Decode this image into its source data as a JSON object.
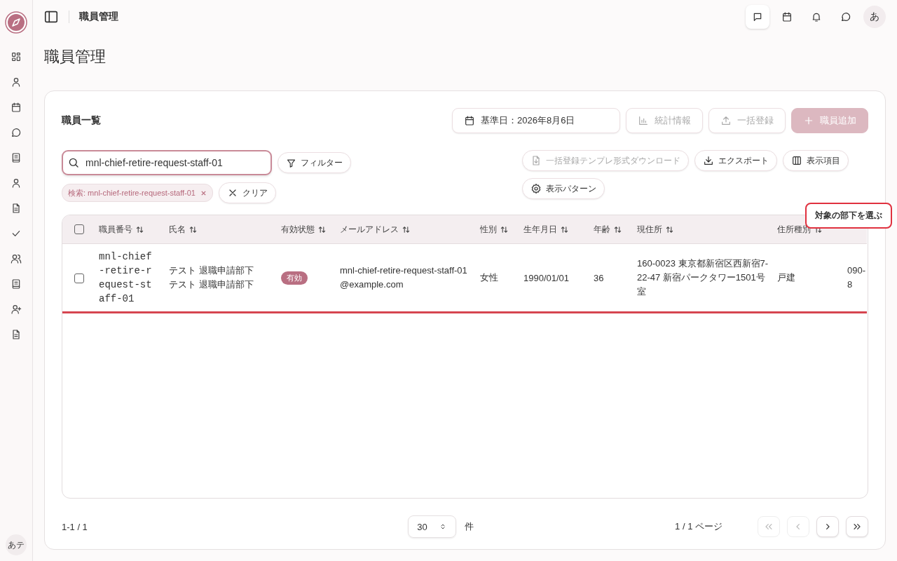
{
  "topbar": {
    "title": "職員管理",
    "avatar": "あ"
  },
  "sidebar": {
    "avatar": "あテ"
  },
  "page_title": "職員管理",
  "card": {
    "title": "職員一覧",
    "header_buttons": [
      {
        "label": "基準日：2026年8月6日",
        "kind": "date",
        "disabled": false
      },
      {
        "label": "統計情報",
        "kind": "stats",
        "disabled": true
      },
      {
        "label": "一括登録",
        "kind": "upload",
        "disabled": true
      },
      {
        "label": "職員追加",
        "kind": "add",
        "disabled": true
      }
    ],
    "search": {
      "value": "mnl-chief-retire-request-staff-01"
    },
    "filter_button": "フィルター",
    "chips": [
      {
        "label": "検索: mnl-chief-retire-request-staff-01"
      }
    ],
    "clear_button": "クリア",
    "tool_buttons": [
      {
        "label": "一括登録テンプレ形式ダウンロード",
        "kind": "template",
        "disabled": true
      },
      {
        "label": "エクスポート",
        "kind": "export",
        "disabled": false
      },
      {
        "label": "表示項目",
        "kind": "columns",
        "disabled": false
      },
      {
        "label": "表示パターン",
        "kind": "settings",
        "disabled": false
      }
    ],
    "table": {
      "header_checked": false,
      "columns": [
        {
          "label": "職員番号"
        },
        {
          "label": "氏名"
        },
        {
          "label": "有効状態"
        },
        {
          "label": "メールアドレス"
        },
        {
          "label": "性別"
        },
        {
          "label": "生年月日"
        },
        {
          "label": "年齢"
        },
        {
          "label": "現住所"
        },
        {
          "label": "住所種別"
        }
      ],
      "rows": [
        {
          "selected": false,
          "highlighted": true,
          "staff_no": "mnl-chief-retire-request-staff-01",
          "name": [
            "テスト 退職申請部下",
            "テスト 退職申請部下"
          ],
          "status": {
            "label": "有効",
            "kind": "active"
          },
          "email": "mnl-chief-retire-request-staff-01@example.com",
          "gender": "女性",
          "birth_date": "1990/01/01",
          "age": "36",
          "address": "160-0023 東京都新宿区西新宿7-22-47 新宿パークタワー1501号室",
          "address_type": "戸建",
          "phone": "090-8"
        }
      ]
    },
    "tooltip": "対象の部下を選ぶ",
    "pagination": {
      "range": "1-1 / 1",
      "page_size": "30",
      "unit": "件",
      "page_info": "1 / 1 ページ",
      "nav": [
        {
          "kind": "first",
          "disabled": true
        },
        {
          "kind": "prev",
          "disabled": true
        },
        {
          "kind": "next",
          "disabled": false
        },
        {
          "kind": "last",
          "disabled": false
        }
      ]
    }
  }
}
